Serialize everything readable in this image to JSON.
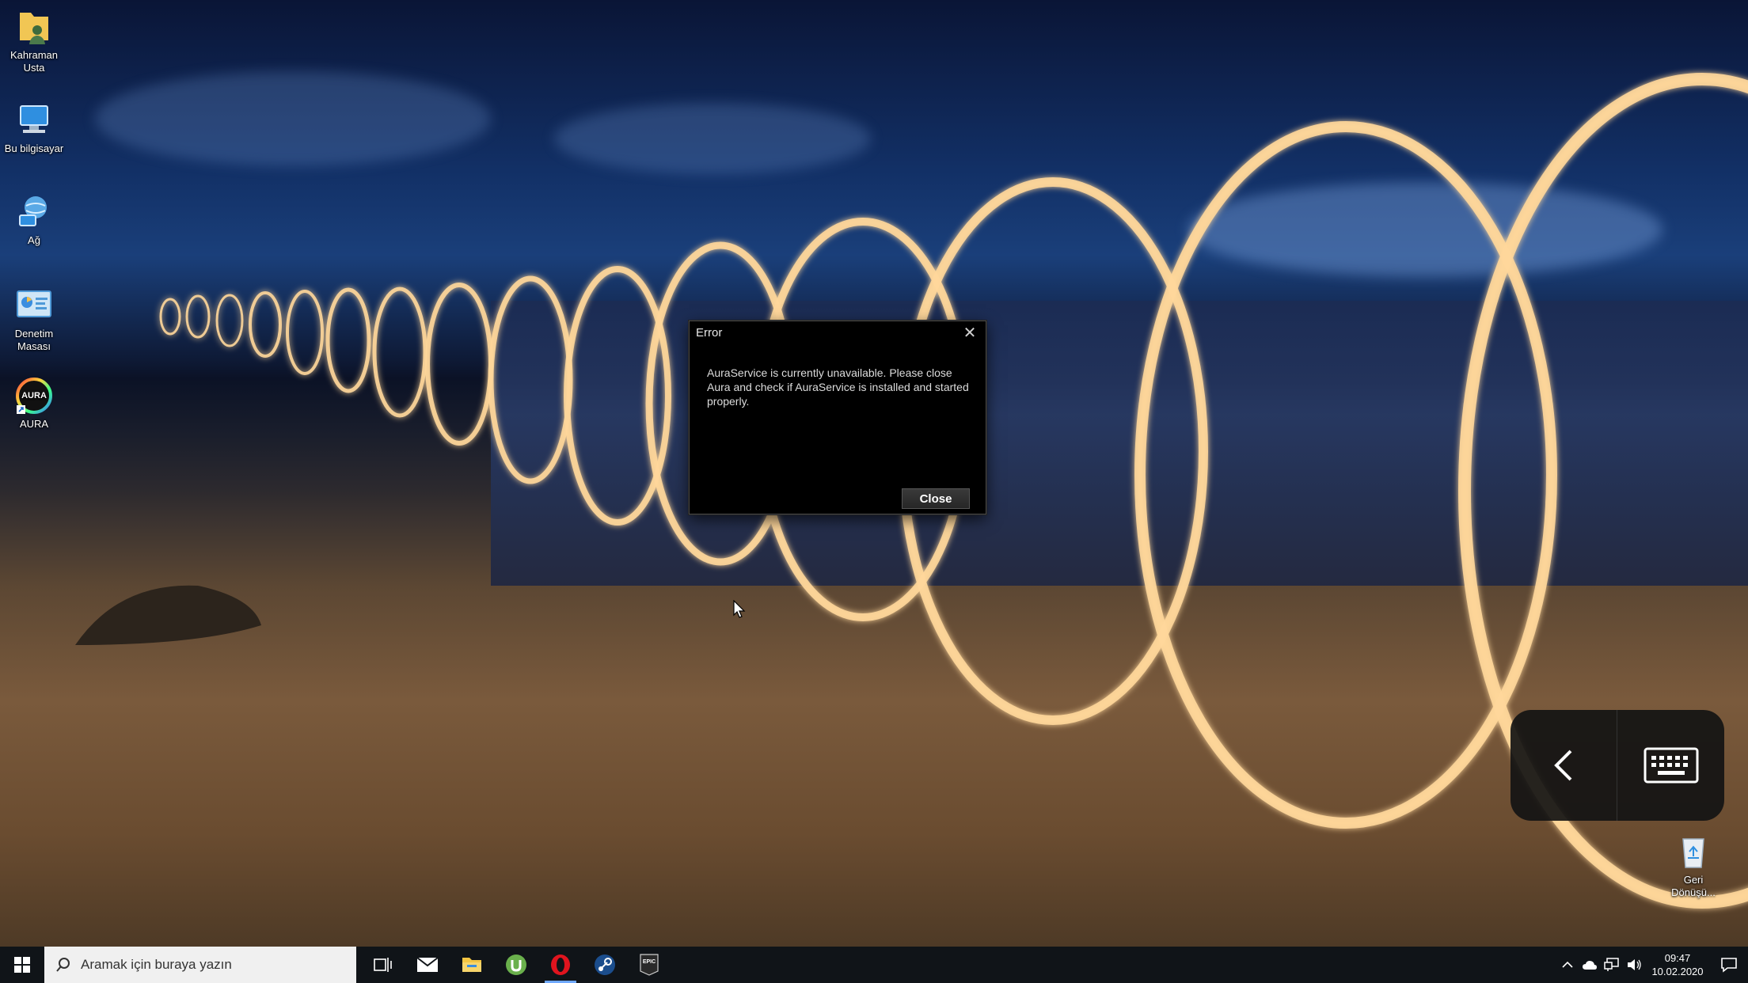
{
  "desktop": {
    "icons": [
      {
        "label": "Kahraman\nUsta",
        "icon": "user-folder-icon"
      },
      {
        "label": "Bu bilgisayar",
        "icon": "computer-icon"
      },
      {
        "label": "Ağ",
        "icon": "network-icon"
      },
      {
        "label": "Denetim\nMasası",
        "icon": "control-panel-icon"
      },
      {
        "label": "AURA",
        "icon": "aura-icon"
      },
      {
        "label": "Geri\nDönüşü...",
        "icon": "recycle-bin-icon"
      }
    ]
  },
  "dialog": {
    "title": "Error",
    "message": "AuraService is currently unavailable. Please close Aura and check if AuraService is installed and started properly.",
    "close_button": "Close",
    "close_glyph": "✕"
  },
  "aura_logo_text": "AURA",
  "taskbar": {
    "search_placeholder": "Aramak için buraya yazın",
    "apps": [
      "task-view-icon",
      "mail-icon",
      "file-explorer-icon",
      "utorrent-icon",
      "opera-icon",
      "steam-icon",
      "epic-games-icon"
    ],
    "epic_text": "EPIC",
    "clock_time": "09:47",
    "clock_date": "10.02.2020"
  },
  "colors": {
    "accent": "#6fa8ff",
    "dialog_bg": "#000000",
    "taskbar_bg": "#101418",
    "opera_red": "#e0141e",
    "utorrent_green": "#6ab04c"
  }
}
